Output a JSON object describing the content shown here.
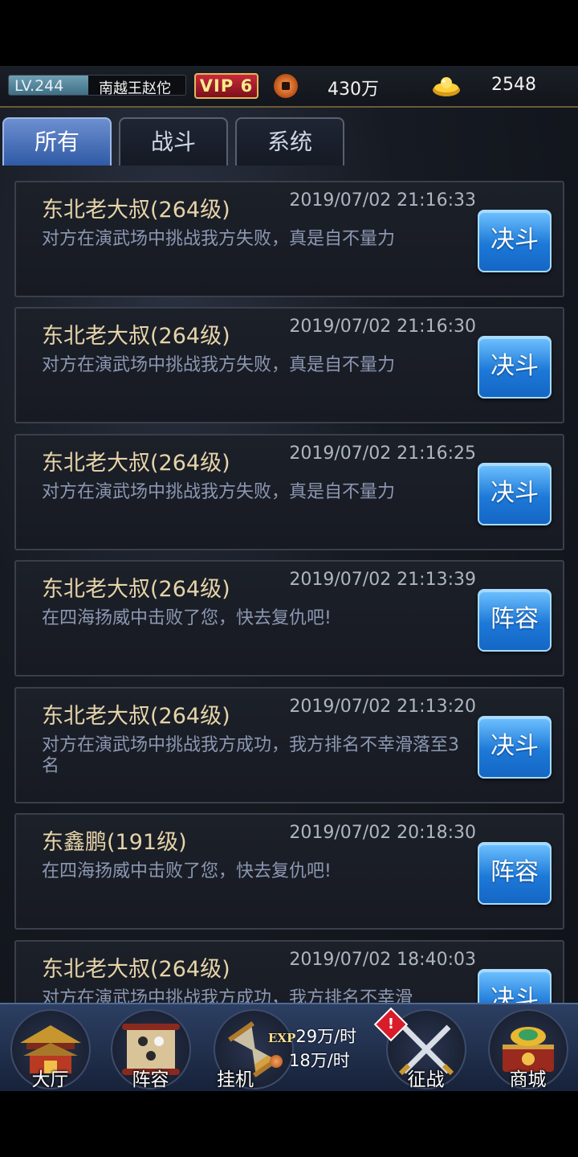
{
  "status": {
    "level": "LV.244",
    "level_progress": 0.45,
    "player_name": "南越王赵佗",
    "vip": "VIP 6",
    "coins": "430万",
    "gold": "2548"
  },
  "tabs": [
    {
      "label": "所有",
      "active": true
    },
    {
      "label": "战斗",
      "active": false
    },
    {
      "label": "系统",
      "active": false
    }
  ],
  "mails": [
    {
      "sender": "东北老大叔(264级)",
      "time": "2019/07/02 21:16:33",
      "body": "对方在演武场中挑战我方失败，真是自不量力",
      "button": "决斗"
    },
    {
      "sender": "东北老大叔(264级)",
      "time": "2019/07/02 21:16:30",
      "body": "对方在演武场中挑战我方失败，真是自不量力",
      "button": "决斗"
    },
    {
      "sender": "东北老大叔(264级)",
      "time": "2019/07/02 21:16:25",
      "body": "对方在演武场中挑战我方失败，真是自不量力",
      "button": "决斗"
    },
    {
      "sender": "东北老大叔(264级)",
      "time": "2019/07/02 21:13:39",
      "body": "在四海扬威中击败了您，快去复仇吧!",
      "button": "阵容"
    },
    {
      "sender": "东北老大叔(264级)",
      "time": "2019/07/02 21:13:20",
      "body": "对方在演武场中挑战我方成功，我方排名不幸滑落至3名",
      "button": "决斗"
    },
    {
      "sender": "东鑫鹏(191级)",
      "time": "2019/07/02 20:18:30",
      "body": "在四海扬威中击败了您，快去复仇吧!",
      "button": "阵容"
    },
    {
      "sender": "东北老大叔(264级)",
      "time": "2019/07/02 18:40:03",
      "body": "对方在演武场中挑战我方成功，我方排名不幸滑",
      "button": "决斗"
    }
  ],
  "nav": {
    "hall": "大厅",
    "lineup": "阵容",
    "idle": "挂机",
    "exp_tag": "EXP",
    "exp_rate": "29万/时",
    "coin_rate": "18万/时",
    "alert": "!",
    "campaign": "征战",
    "shop": "商城"
  }
}
